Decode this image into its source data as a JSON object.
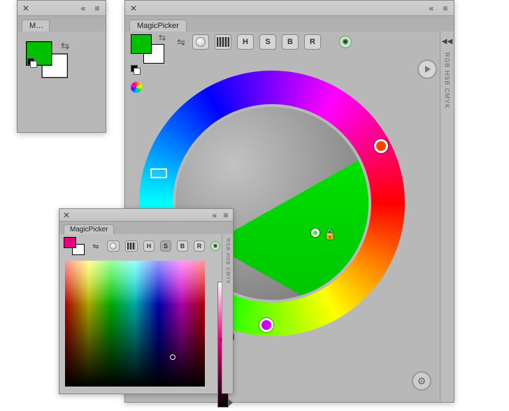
{
  "mini": {
    "title": "M…",
    "fg": "#00c000",
    "bg": "#ffffff"
  },
  "big": {
    "title": "MagicPicker",
    "sideLabel": "RGB HSB CMYK",
    "fg": "#00c000",
    "bg": "#ffffff",
    "modes": {
      "h": "H",
      "s": "S",
      "b": "B",
      "r": "R"
    }
  },
  "spec": {
    "title": "MagicPicker",
    "sideLabel": "RGB HSB CMYK",
    "fg": "#e6007e",
    "bg": "#ffffff",
    "modes": {
      "h": "H",
      "s": "S",
      "b": "B",
      "r": "R"
    }
  }
}
